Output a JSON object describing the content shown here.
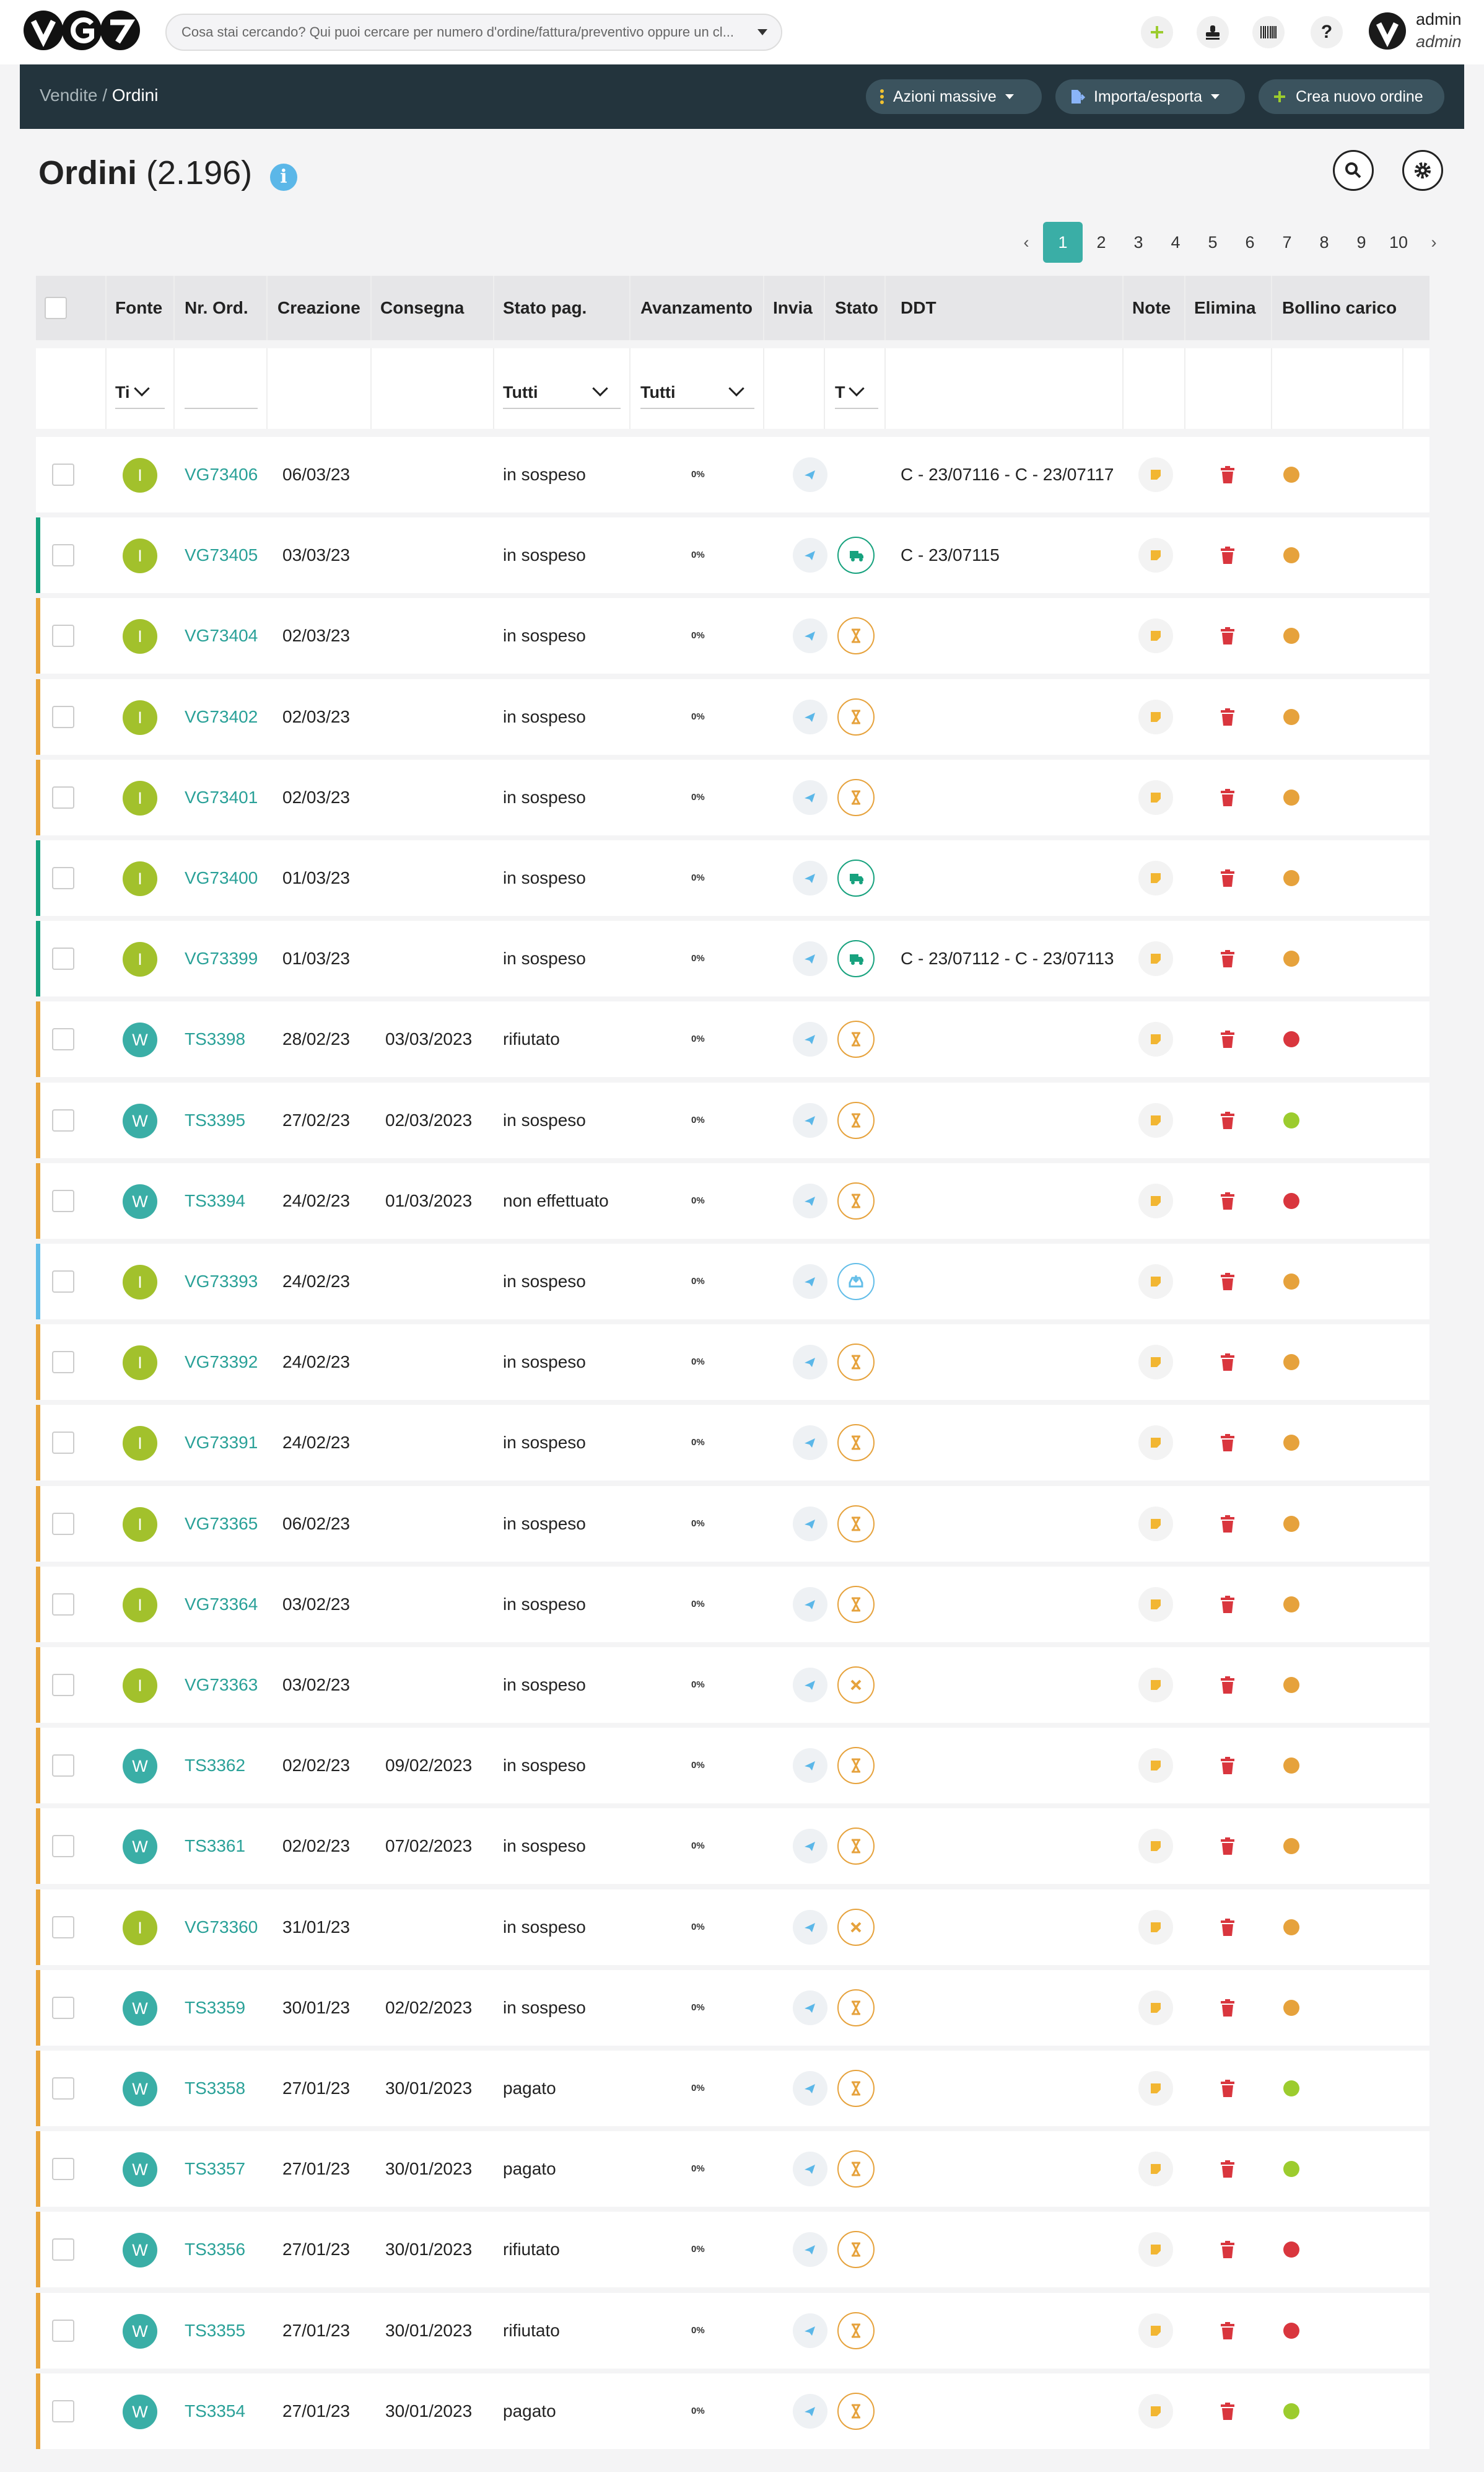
{
  "header": {
    "logo_text": "VG7",
    "search_placeholder": "Cosa stai cercando? Qui puoi cercare per numero d'ordine/fattura/preventivo oppure un cl...",
    "user_name": "admin",
    "user_role": "admin",
    "icons": [
      "plus-icon",
      "stamp-icon",
      "barcode-icon",
      "help-icon",
      "avatar"
    ]
  },
  "navbar": {
    "breadcrumb_parent": "Vendite",
    "breadcrumb_sep": " / ",
    "breadcrumb_current": "Ordini",
    "bulk_actions": "Azioni massive",
    "import_export": "Importa/esporta",
    "create_order": "Crea nuovo ordine"
  },
  "page": {
    "title": "Ordini",
    "count": "(2.196)",
    "info": "i"
  },
  "pagination": {
    "prev": "‹",
    "next": "›",
    "pages": [
      "1",
      "2",
      "3",
      "4",
      "5",
      "6",
      "7",
      "8",
      "9",
      "10"
    ],
    "current": "1"
  },
  "columns": {
    "source": "Fonte",
    "order_no": "Nr. Ord.",
    "created": "Creazione",
    "delivery": "Consegna",
    "pay_status": "Stato pag.",
    "progress": "Avanzamento",
    "send": "Invia",
    "status": "Stato",
    "ddt": "DDT",
    "notes": "Note",
    "delete": "Elimina",
    "label": "Bollino carico"
  },
  "filters": {
    "source": "Ti",
    "pay_status": "Tutti",
    "progress": "Tutti",
    "status": "T"
  },
  "colors": {
    "accent": "#3aaea6",
    "link": "#2aa198",
    "navbar": "#23343d",
    "src_I": "#a2c12c",
    "src_W": "#3aaea6",
    "stripe_orange": "#e9a53b",
    "stripe_green": "#17a27e",
    "stripe_blue": "#62bde8",
    "dot_orange": "#e6a23c",
    "dot_red": "#d9363e",
    "dot_green": "#9ccc2e",
    "delete_red": "#d9363e"
  },
  "rows": [
    {
      "src": "I",
      "order": "VG73406",
      "created": "06/03/23",
      "delivery": "",
      "pay": "in sospeso",
      "progress": "0%",
      "status": "none",
      "stripe": "none",
      "ddt": "C - 23/07116 - C - 23/07117",
      "dot": "orange"
    },
    {
      "src": "I",
      "order": "VG73405",
      "created": "03/03/23",
      "delivery": "",
      "pay": "in sospeso",
      "progress": "0%",
      "status": "truck",
      "stripe": "green",
      "ddt": "C - 23/07115",
      "dot": "orange"
    },
    {
      "src": "I",
      "order": "VG73404",
      "created": "02/03/23",
      "delivery": "",
      "pay": "in sospeso",
      "progress": "0%",
      "status": "hourglass",
      "stripe": "orange",
      "ddt": "",
      "dot": "orange"
    },
    {
      "src": "I",
      "order": "VG73402",
      "created": "02/03/23",
      "delivery": "",
      "pay": "in sospeso",
      "progress": "0%",
      "status": "hourglass",
      "stripe": "orange",
      "ddt": "",
      "dot": "orange"
    },
    {
      "src": "I",
      "order": "VG73401",
      "created": "02/03/23",
      "delivery": "",
      "pay": "in sospeso",
      "progress": "0%",
      "status": "hourglass",
      "stripe": "orange",
      "ddt": "",
      "dot": "orange"
    },
    {
      "src": "I",
      "order": "VG73400",
      "created": "01/03/23",
      "delivery": "",
      "pay": "in sospeso",
      "progress": "0%",
      "status": "truck",
      "stripe": "green",
      "ddt": "",
      "dot": "orange"
    },
    {
      "src": "I",
      "order": "VG73399",
      "created": "01/03/23",
      "delivery": "",
      "pay": "in sospeso",
      "progress": "0%",
      "status": "truck",
      "stripe": "green",
      "ddt": "C - 23/07112 - C - 23/07113",
      "dot": "orange"
    },
    {
      "src": "W",
      "order": "TS3398",
      "created": "28/02/23",
      "delivery": "03/03/2023",
      "pay": "rifiutato",
      "progress": "0%",
      "status": "hourglass",
      "stripe": "orange",
      "ddt": "",
      "dot": "red"
    },
    {
      "src": "W",
      "order": "TS3395",
      "created": "27/02/23",
      "delivery": "02/03/2023",
      "pay": "in sospeso",
      "progress": "0%",
      "status": "hourglass",
      "stripe": "orange",
      "ddt": "",
      "dot": "green"
    },
    {
      "src": "W",
      "order": "TS3394",
      "created": "24/02/23",
      "delivery": "01/03/2023",
      "pay": "non effettuato",
      "progress": "0%",
      "status": "hourglass",
      "stripe": "orange",
      "ddt": "",
      "dot": "red"
    },
    {
      "src": "I",
      "order": "VG73393",
      "created": "24/02/23",
      "delivery": "",
      "pay": "in sospeso",
      "progress": "0%",
      "status": "inbox",
      "stripe": "blue",
      "ddt": "",
      "dot": "orange"
    },
    {
      "src": "I",
      "order": "VG73392",
      "created": "24/02/23",
      "delivery": "",
      "pay": "in sospeso",
      "progress": "0%",
      "status": "hourglass",
      "stripe": "orange",
      "ddt": "",
      "dot": "orange"
    },
    {
      "src": "I",
      "order": "VG73391",
      "created": "24/02/23",
      "delivery": "",
      "pay": "in sospeso",
      "progress": "0%",
      "status": "hourglass",
      "stripe": "orange",
      "ddt": "",
      "dot": "orange"
    },
    {
      "src": "I",
      "order": "VG73365",
      "created": "06/02/23",
      "delivery": "",
      "pay": "in sospeso",
      "progress": "0%",
      "status": "hourglass",
      "stripe": "orange",
      "ddt": "",
      "dot": "orange"
    },
    {
      "src": "I",
      "order": "VG73364",
      "created": "03/02/23",
      "delivery": "",
      "pay": "in sospeso",
      "progress": "0%",
      "status": "hourglass",
      "stripe": "orange",
      "ddt": "",
      "dot": "orange"
    },
    {
      "src": "I",
      "order": "VG73363",
      "created": "03/02/23",
      "delivery": "",
      "pay": "in sospeso",
      "progress": "0%",
      "status": "tools",
      "stripe": "orange",
      "ddt": "",
      "dot": "orange"
    },
    {
      "src": "W",
      "order": "TS3362",
      "created": "02/02/23",
      "delivery": "09/02/2023",
      "pay": "in sospeso",
      "progress": "0%",
      "status": "hourglass",
      "stripe": "orange",
      "ddt": "",
      "dot": "orange"
    },
    {
      "src": "W",
      "order": "TS3361",
      "created": "02/02/23",
      "delivery": "07/02/2023",
      "pay": "in sospeso",
      "progress": "0%",
      "status": "hourglass",
      "stripe": "orange",
      "ddt": "",
      "dot": "orange"
    },
    {
      "src": "I",
      "order": "VG73360",
      "created": "31/01/23",
      "delivery": "",
      "pay": "in sospeso",
      "progress": "0%",
      "status": "tools",
      "stripe": "orange",
      "ddt": "",
      "dot": "orange"
    },
    {
      "src": "W",
      "order": "TS3359",
      "created": "30/01/23",
      "delivery": "02/02/2023",
      "pay": "in sospeso",
      "progress": "0%",
      "status": "hourglass",
      "stripe": "orange",
      "ddt": "",
      "dot": "orange"
    },
    {
      "src": "W",
      "order": "TS3358",
      "created": "27/01/23",
      "delivery": "30/01/2023",
      "pay": "pagato",
      "progress": "0%",
      "status": "hourglass",
      "stripe": "orange",
      "ddt": "",
      "dot": "green"
    },
    {
      "src": "W",
      "order": "TS3357",
      "created": "27/01/23",
      "delivery": "30/01/2023",
      "pay": "pagato",
      "progress": "0%",
      "status": "hourglass",
      "stripe": "orange",
      "ddt": "",
      "dot": "green"
    },
    {
      "src": "W",
      "order": "TS3356",
      "created": "27/01/23",
      "delivery": "30/01/2023",
      "pay": "rifiutato",
      "progress": "0%",
      "status": "hourglass",
      "stripe": "orange",
      "ddt": "",
      "dot": "red"
    },
    {
      "src": "W",
      "order": "TS3355",
      "created": "27/01/23",
      "delivery": "30/01/2023",
      "pay": "rifiutato",
      "progress": "0%",
      "status": "hourglass",
      "stripe": "orange",
      "ddt": "",
      "dot": "red"
    },
    {
      "src": "W",
      "order": "TS3354",
      "created": "27/01/23",
      "delivery": "30/01/2023",
      "pay": "pagato",
      "progress": "0%",
      "status": "hourglass",
      "stripe": "orange",
      "ddt": "",
      "dot": "green"
    }
  ]
}
